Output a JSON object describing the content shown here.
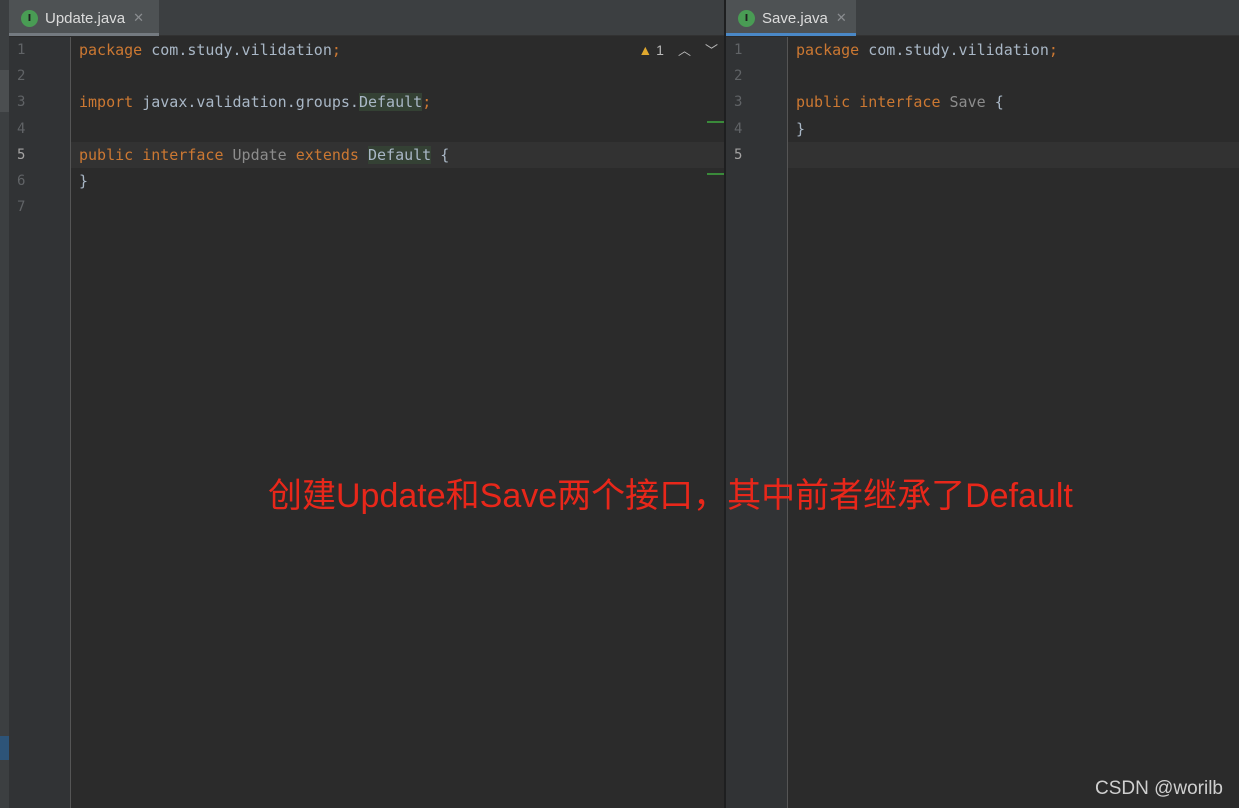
{
  "editor_left": {
    "tab": {
      "icon": "interface-file-icon",
      "icon_letter": "I",
      "label": "Update.java"
    },
    "inspection": {
      "warning_count": "1"
    },
    "line_numbers": [
      "1",
      "2",
      "3",
      "4",
      "5",
      "6",
      "7"
    ],
    "current_line": 5,
    "lines": {
      "l1": {
        "kw": "package",
        "rest": " com.study.vilidation",
        "semi": ";"
      },
      "l3": {
        "kw": "import",
        "rest": " javax.validation.groups.",
        "hl": "Default",
        "semi": ";"
      },
      "l5": {
        "kw1": "public",
        "kw2": "interface",
        "name": "Update",
        "kw3": "extends",
        "hl": "Default",
        "brace": "{"
      },
      "l6": {
        "brace": "}"
      }
    }
  },
  "editor_right": {
    "tab": {
      "icon": "interface-file-icon",
      "icon_letter": "I",
      "label": "Save.java"
    },
    "line_numbers": [
      "1",
      "2",
      "3",
      "4",
      "5"
    ],
    "current_line": 5,
    "lines": {
      "l1": {
        "kw": "package",
        "rest": " com.study.vilidation",
        "semi": ";"
      },
      "l3": {
        "kw1": "public",
        "kw2": "interface",
        "name": "Save",
        "brace": "{"
      },
      "l4": {
        "brace": "}"
      }
    }
  },
  "annotation": "创建Update和Save两个接口，其中前者继承了Default",
  "watermark": "CSDN @worilb",
  "colors": {
    "keyword": "#cc7832",
    "plain": "#a9b7c6",
    "unused_identifier": "#8c8c8c",
    "annotation_red": "#e8271a",
    "interface_icon_green": "#499c54",
    "warning_yellow": "#e0a82e"
  }
}
